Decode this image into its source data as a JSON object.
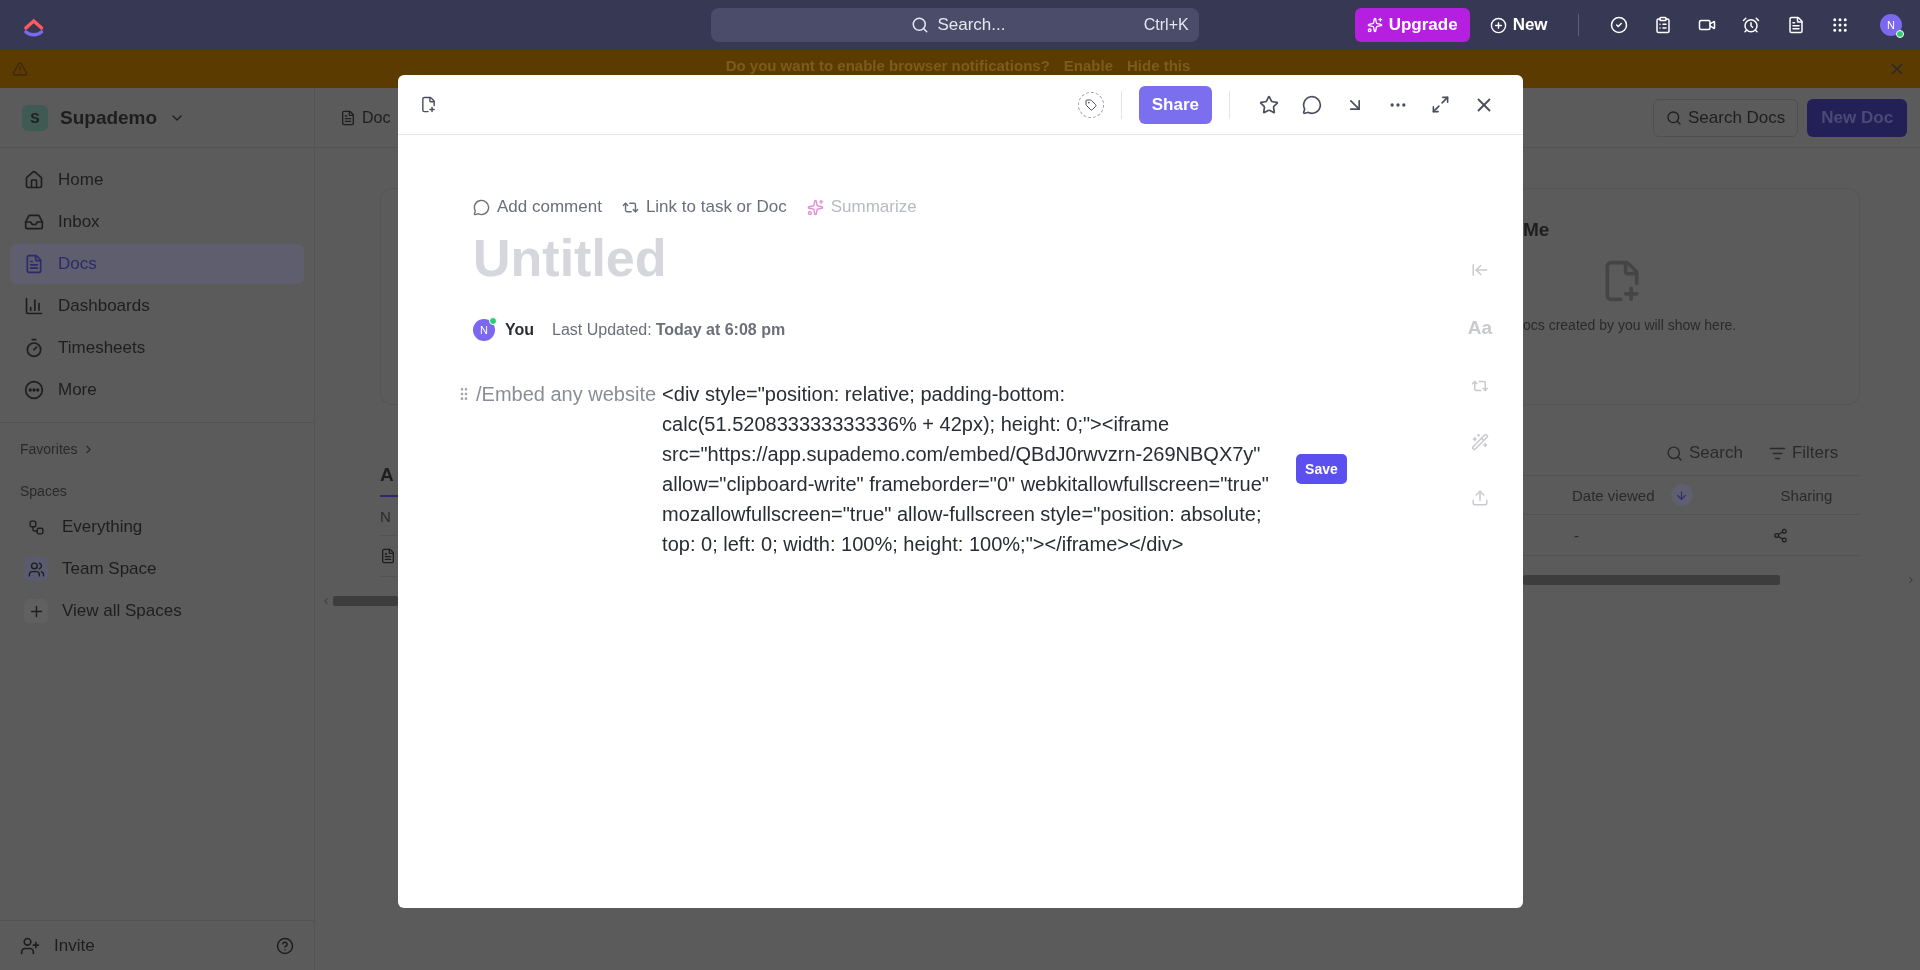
{
  "topbar": {
    "search": {
      "placeholder": "Search...",
      "shortcut": "Ctrl+K"
    },
    "upgrade": "Upgrade",
    "new": "New",
    "avatar": {
      "initial": "N",
      "online": true
    }
  },
  "banner": {
    "message": "Do you want to enable browser notifications?",
    "actions": [
      "Enable",
      "Hide this"
    ]
  },
  "sidebar": {
    "workspace": {
      "initial": "S",
      "name": "Supademo"
    },
    "nav": [
      {
        "label": "Home",
        "selected": false
      },
      {
        "label": "Inbox",
        "selected": false
      },
      {
        "label": "Docs",
        "selected": true
      },
      {
        "label": "Dashboards",
        "selected": false
      },
      {
        "label": "Timesheets",
        "selected": false
      },
      {
        "label": "More",
        "selected": false
      }
    ],
    "favorites": "Favorites",
    "spaces_heading": "Spaces",
    "spaces": [
      {
        "label": "Everything"
      },
      {
        "label": "Team Space"
      },
      {
        "label": "View all Spaces"
      }
    ],
    "invite": "Invite"
  },
  "background": {
    "breadcrumb": "Doc",
    "search_docs": "Search Docs",
    "new_doc": "New Doc",
    "card": {
      "title": "Me",
      "empty_text": "ocs created by you will show here."
    },
    "tab": "A",
    "table": {
      "search": "Search",
      "filters": "Filters",
      "columns": [
        {
          "label": "N",
          "sorted": false
        },
        {
          "label": "Date viewed",
          "sorted": true
        },
        {
          "label": "Sharing",
          "sorted": false
        }
      ],
      "row": {
        "date_viewed": "-"
      }
    }
  },
  "doc": {
    "share": "Share",
    "actions": [
      {
        "label": "Add comment",
        "disabled": false
      },
      {
        "label": "Link to task or Doc",
        "disabled": false
      },
      {
        "label": "Summarize",
        "disabled": true
      }
    ],
    "title": "Untitled",
    "author": {
      "initial": "N",
      "name": "You",
      "online": true
    },
    "last_updated_label": "Last Updated:",
    "last_updated": "Today at 6:08 pm",
    "block": {
      "command": "/Embed any website",
      "content": "<div style=\"position: relative; padding-bottom: calc(51.520833333333336% + 42px); height: 0;\"><iframe src=\"https://app.supademo.com/embed/QBdJ0rwvzrn-269NBQX7y\" allow=\"clipboard-write\" frameborder=\"0\" webkitallowfullscreen=\"true\" mozallowfullscreen=\"true\" allow-fullscreen style=\"position: absolute; top: 0; left: 0; width: 100%; height: 100%;\"></iframe></div>",
      "save": "Save"
    },
    "rail_label": "Aa"
  }
}
